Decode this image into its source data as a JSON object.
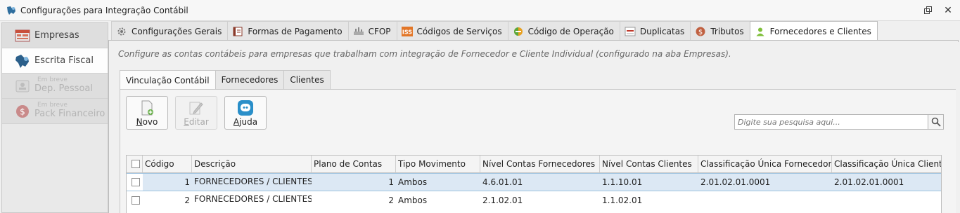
{
  "window": {
    "title": "Configurações para Integração Contábil"
  },
  "leftnav": {
    "items": [
      {
        "label": "Empresas",
        "small": "",
        "state": "normal"
      },
      {
        "label": "Escrita Fiscal",
        "small": "",
        "state": "active"
      },
      {
        "label": "Dep. Pessoal",
        "small": "Em breve",
        "state": "disabled"
      },
      {
        "label": "Pack Financeiro",
        "small": "Em breve",
        "state": "disabled"
      }
    ]
  },
  "tabs": [
    {
      "label": "Configurações Gerais",
      "icon": "gear-icon"
    },
    {
      "label": "Formas de Pagamento",
      "icon": "ledger-icon"
    },
    {
      "label": "CFOP",
      "icon": "cfop-icon"
    },
    {
      "label": "Códigos de Serviços",
      "icon": "iss-icon"
    },
    {
      "label": "Código de Operação",
      "icon": "operation-icon"
    },
    {
      "label": "Duplicatas",
      "icon": "document-icon"
    },
    {
      "label": "Tributos",
      "icon": "dollar-icon"
    },
    {
      "label": "Fornecedores e Clientes",
      "icon": "user-icon"
    }
  ],
  "description": "Configure as contas contábeis para empresas que trabalham com integração de Fornecedor e Cliente Individual (configurado na aba Empresas).",
  "subtabs": [
    {
      "label": "Vinculação Contábil"
    },
    {
      "label": "Fornecedores"
    },
    {
      "label": "Clientes"
    }
  ],
  "toolbar": {
    "new": {
      "first": "N",
      "rest": "ovo"
    },
    "edit": {
      "first": "E",
      "rest": "ditar"
    },
    "help": {
      "first": "A",
      "rest": "juda"
    }
  },
  "search": {
    "placeholder": "Digite sua pesquisa aqui..."
  },
  "grid": {
    "columns": [
      "Código",
      "Descrição",
      "Plano de Contas",
      "Tipo Movimento",
      "Nível Contas Fornecedores",
      "Nível Contas Clientes",
      "Classificação Única Fornecedor",
      "Classificação Única Clientes"
    ],
    "rows": [
      {
        "codigo": "1",
        "descricao": "FORNECEDORES / CLIENTES",
        "plano": "",
        "tipo_num": "1",
        "tipo": "Ambos",
        "nivel_forn": "4.6.01.01",
        "nivel_cli": "1.1.10.01",
        "class_forn": "2.01.02.01.0001",
        "class_cli": "2.01.02.01.0001"
      },
      {
        "codigo": "2",
        "descricao": "FORNECEDORES / CLIENTES",
        "plano": "",
        "tipo_num": "2",
        "tipo": "Ambos",
        "nivel_forn": "2.1.02.01",
        "nivel_cli": "1.1.02.01",
        "class_forn": "",
        "class_cli": ""
      }
    ]
  },
  "colors": {
    "selected_row": "#dce8f4",
    "accent": "#2a8fc9"
  }
}
